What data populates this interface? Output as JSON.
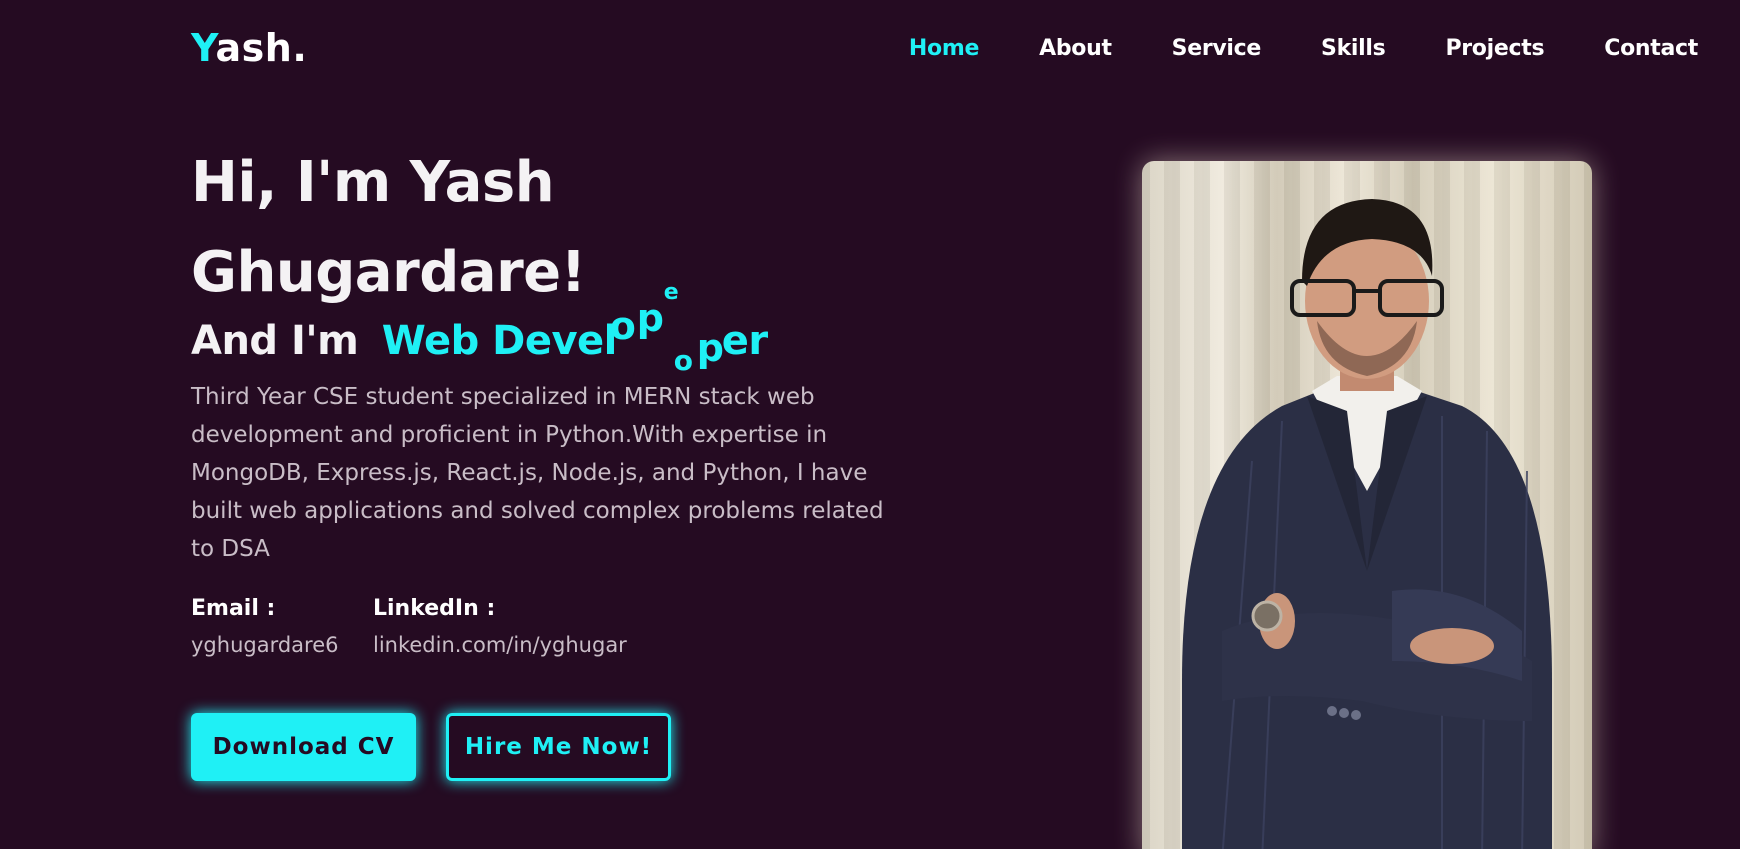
{
  "logo": {
    "initial": "Y",
    "rest": "ash."
  },
  "nav": {
    "items": [
      {
        "label": "Home",
        "active": true
      },
      {
        "label": "About",
        "active": false
      },
      {
        "label": "Service",
        "active": false
      },
      {
        "label": "Skills",
        "active": false
      },
      {
        "label": "Projects",
        "active": false
      },
      {
        "label": "Contact",
        "active": false
      }
    ]
  },
  "hero": {
    "title_line1": "Hi, I'm Yash",
    "title_line2": "Ghugardare!",
    "subtitle_prefix": "And I'm",
    "role_text": "Web Devel",
    "role_fragments": [
      "o",
      "p",
      "e",
      "o",
      "p",
      "er"
    ],
    "description": "Third Year CSE student specialized in MERN stack web development and proficient in Python.With expertise in MongoDB, Express.js, React.js, Node.js, and Python, I have built web applications and solved complex problems related to DSA"
  },
  "contact": {
    "email_label": "Email :",
    "email_value": "yghugardare6",
    "linkedin_label": "LinkedIn :",
    "linkedin_value": "linkedin.com/in/yghugar"
  },
  "buttons": {
    "download_label": "Download CV",
    "hire_label": "Hire Me Now!"
  },
  "colors": {
    "background": "#250b22",
    "accent": "#1ff0f5",
    "text": "#ffffff",
    "muted": "#c9bdc7"
  }
}
